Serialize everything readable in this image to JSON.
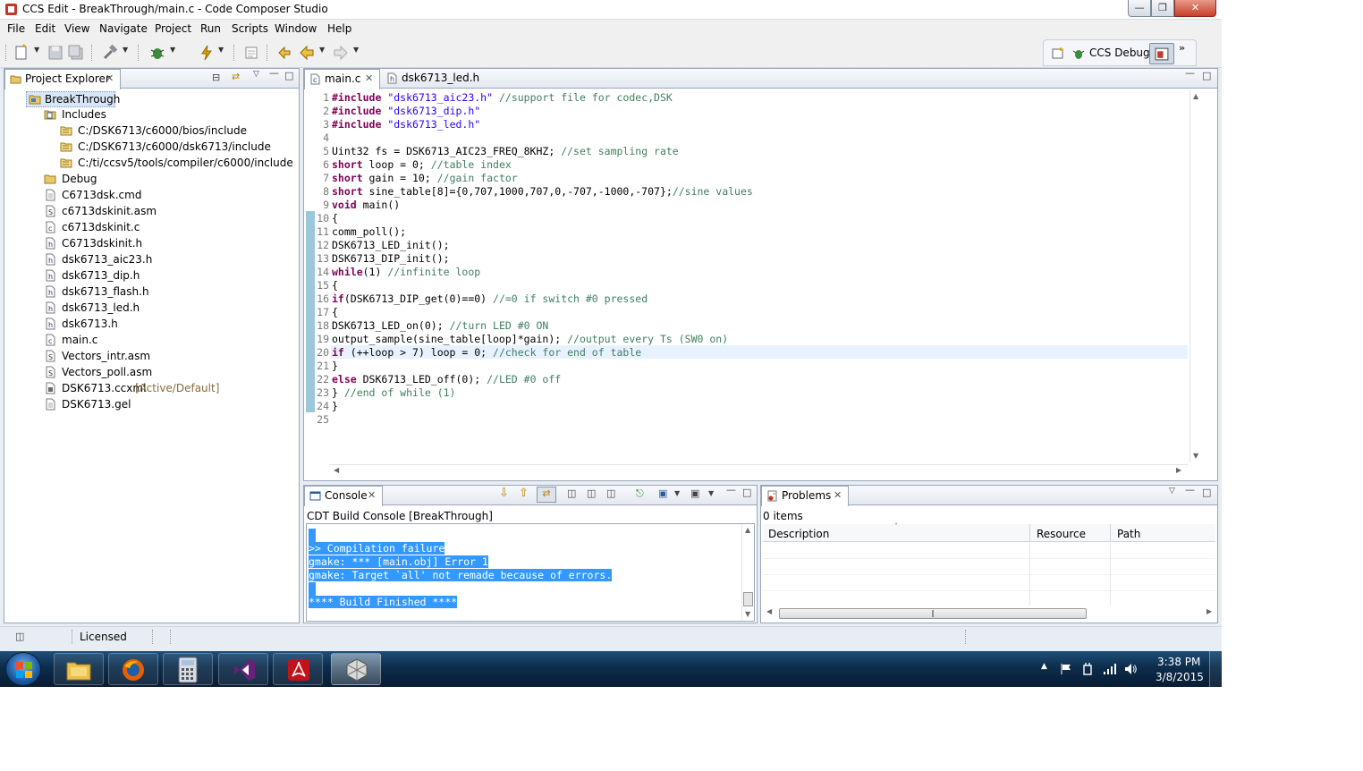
{
  "window": {
    "title": "CCS Edit - BreakThrough/main.c - Code Composer Studio"
  },
  "menu": [
    "File",
    "Edit",
    "View",
    "Navigate",
    "Project",
    "Run",
    "Scripts",
    "Window",
    "Help"
  ],
  "perspective": {
    "label": "CCS Debug"
  },
  "project_explorer": {
    "tab_label": "Project Explorer",
    "project": "BreakThrough",
    "items": [
      {
        "label": "Includes",
        "icon": "includes-icon"
      },
      {
        "label": "C:/DSK6713/c6000/bios/include",
        "icon": "include-folder-icon"
      },
      {
        "label": "C:/DSK6713/c6000/dsk6713/include",
        "icon": "include-folder-icon"
      },
      {
        "label": "C:/ti/ccsv5/tools/compiler/c6000/include",
        "icon": "include-folder-icon"
      },
      {
        "label": "Debug",
        "icon": "folder-icon"
      },
      {
        "label": "C6713dsk.cmd",
        "icon": "file-icon"
      },
      {
        "label": "c6713dskinit.asm",
        "icon": "asm-file-icon"
      },
      {
        "label": "c6713dskinit.c",
        "icon": "c-file-icon"
      },
      {
        "label": "C6713dskinit.h",
        "icon": "h-file-icon"
      },
      {
        "label": "dsk6713_aic23.h",
        "icon": "h-file-icon"
      },
      {
        "label": "dsk6713_dip.h",
        "icon": "h-file-icon"
      },
      {
        "label": "dsk6713_flash.h",
        "icon": "h-file-icon"
      },
      {
        "label": "dsk6713_led.h",
        "icon": "h-file-icon"
      },
      {
        "label": "dsk6713.h",
        "icon": "h-file-icon"
      },
      {
        "label": "main.c",
        "icon": "c-file-icon"
      },
      {
        "label": "Vectors_intr.asm",
        "icon": "asm-file-icon"
      },
      {
        "label": "Vectors_poll.asm",
        "icon": "asm-file-icon"
      },
      {
        "label": "DSK6713.ccxml",
        "decoration": "[Active/Default]",
        "icon": "ccxml-file-icon"
      },
      {
        "label": "DSK6713.gel",
        "icon": "file-icon"
      }
    ]
  },
  "editor": {
    "tabs": [
      {
        "label": "main.c",
        "active": true
      },
      {
        "label": "dsk6713_led.h",
        "active": false
      }
    ],
    "lines": [
      "#include \"dsk6713_aic23.h\" //support file for codec,DSK",
      "#include \"dsk6713_dip.h\"",
      "#include \"dsk6713_led.h\"",
      "",
      "Uint32 fs = DSK6713_AIC23_FREQ_8KHZ; //set sampling rate",
      "short loop = 0; //table index",
      "short gain = 10; //gain factor",
      "short sine_table[8]={0,707,1000,707,0,-707,-1000,-707};//sine values",
      "void main()",
      "{",
      "comm_poll();",
      "DSK6713_LED_init();",
      "DSK6713_DIP_init();",
      "while(1) //infinite loop",
      "{",
      "if(DSK6713_DIP_get(0)==0) //=0 if switch #0 pressed",
      "{",
      "DSK6713_LED_on(0); //turn LED #0 ON",
      "output_sample(sine_table[loop]*gain); //output every Ts (SW0 on)",
      "if (++loop > 7) loop = 0; //check for end of table",
      "}",
      "else DSK6713_LED_off(0); //LED #0 off",
      "} //end of while (1)",
      "}",
      ""
    ]
  },
  "console": {
    "tab_label": "Console",
    "header": "CDT Build Console [BreakThrough]",
    "lines": [
      ">> Compilation failure",
      "gmake: *** [main.obj] Error 1",
      "gmake: Target `all' not remade because of errors.",
      "",
      "**** Build Finished ****"
    ]
  },
  "problems": {
    "tab_label": "Problems",
    "count": "0 items",
    "columns": [
      "Description",
      "Resource",
      "Path"
    ]
  },
  "status": {
    "license": "Licensed"
  },
  "taskbar": {
    "time": "3:38 PM",
    "date": "3/8/2015",
    "apps": [
      "file-explorer-icon",
      "firefox-icon",
      "calculator-icon",
      "visual-studio-icon",
      "acrobat-icon",
      "ccs-app-icon"
    ]
  }
}
